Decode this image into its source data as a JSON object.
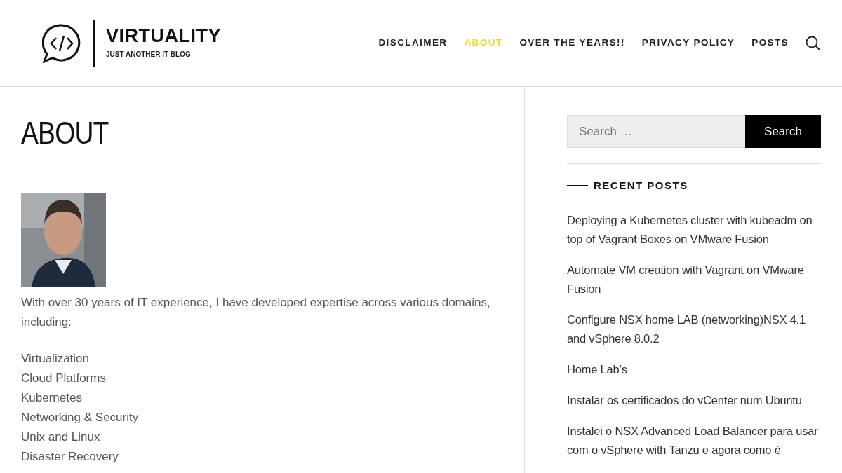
{
  "site": {
    "title": "VIRTUALITY",
    "tagline": "JUST ANOTHER IT BLOG"
  },
  "nav": [
    {
      "label": "DISCLAIMER",
      "selected": false
    },
    {
      "label": "ABOUT",
      "selected": true
    },
    {
      "label": "OVER THE YEARS!!",
      "selected": false
    },
    {
      "label": "PRIVACY POLICY",
      "selected": false
    },
    {
      "label": "POSTS",
      "selected": false
    }
  ],
  "page": {
    "title": "ABOUT",
    "intro": "With over 30 years of IT experience, I have developed expertise across various domains, including:",
    "domains": [
      "Virtualization",
      "Cloud Platforms",
      "Kubernetes",
      "Networking & Security",
      "Unix and Linux",
      "Disaster Recovery"
    ]
  },
  "sidebar": {
    "search": {
      "placeholder": "Search …",
      "button": "Search"
    },
    "recent_title": "RECENT POSTS",
    "recent_posts": [
      "Deploying a Kubernetes cluster with kubeadm on top of Vagrant Boxes on VMware Fusion",
      "Automate VM creation with Vagrant on VMware Fusion",
      "Configure NSX home LAB (networking)NSX 4.1 and vSphere 8.0.2",
      "Home Lab’s",
      "Instalar os certificados do vCenter num Ubuntu",
      "Instalei o NSX Advanced Load Balancer para usar com o vSphere with Tanzu e agora como é"
    ]
  }
}
